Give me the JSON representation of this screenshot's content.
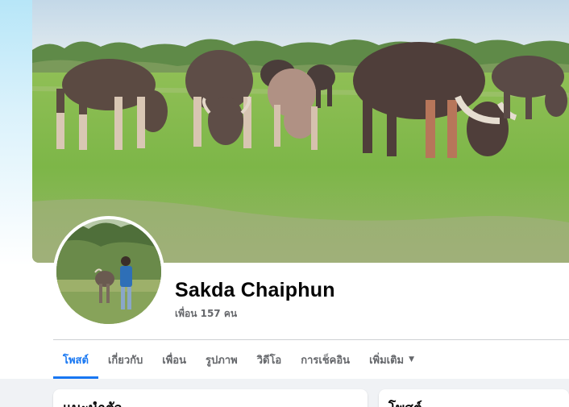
{
  "profile": {
    "name": "Sakda Chaiphun",
    "friends": "เพื่อน 157 คน"
  },
  "tabs": [
    {
      "label": "โพสต์"
    },
    {
      "label": "เกี่ยวกับ"
    },
    {
      "label": "เพื่อน"
    },
    {
      "label": "รูปภาพ"
    },
    {
      "label": "วิดีโอ"
    },
    {
      "label": "การเช็คอิน"
    },
    {
      "label": "เพิ่มเติม"
    }
  ],
  "sections": {
    "intro_title": "แนะนำตัว",
    "posts_title": "โพสต์"
  },
  "colors": {
    "accent": "#1877f2",
    "text_primary": "#050505",
    "text_secondary": "#65676b",
    "background_gray": "#f0f2f5"
  },
  "icons": {
    "more_caret": "caret-down-icon"
  }
}
